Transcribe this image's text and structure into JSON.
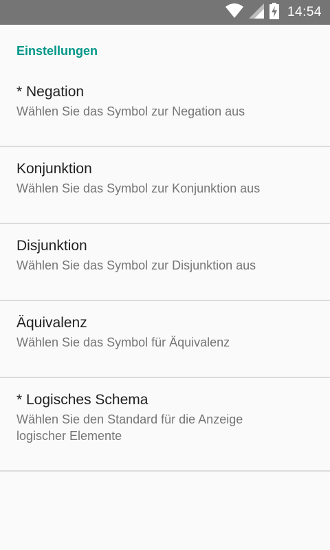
{
  "status_bar": {
    "time": "14:54",
    "icons": [
      "wifi-icon",
      "signal-icon",
      "battery-charging-icon"
    ]
  },
  "settings": {
    "category_title": "Einstellungen",
    "items": [
      {
        "title": "* Negation",
        "summary": "Wählen Sie das Symbol zur Negation aus"
      },
      {
        "title": "Konjunktion",
        "summary": "Wählen Sie das Symbol zur Konjunktion aus"
      },
      {
        "title": "Disjunktion",
        "summary": "Wählen Sie das Symbol zur Disjunktion aus"
      },
      {
        "title": "Äquivalenz",
        "summary": "Wählen Sie das Symbol für Äquivalenz"
      },
      {
        "title": "* Logisches Schema",
        "summary": "Wählen Sie den Standard für die Anzeige logischer Elemente"
      }
    ]
  },
  "colors": {
    "status_bar": "#757575",
    "accent": "#009688",
    "background": "#fafafa",
    "divider": "#dcdcdc"
  }
}
